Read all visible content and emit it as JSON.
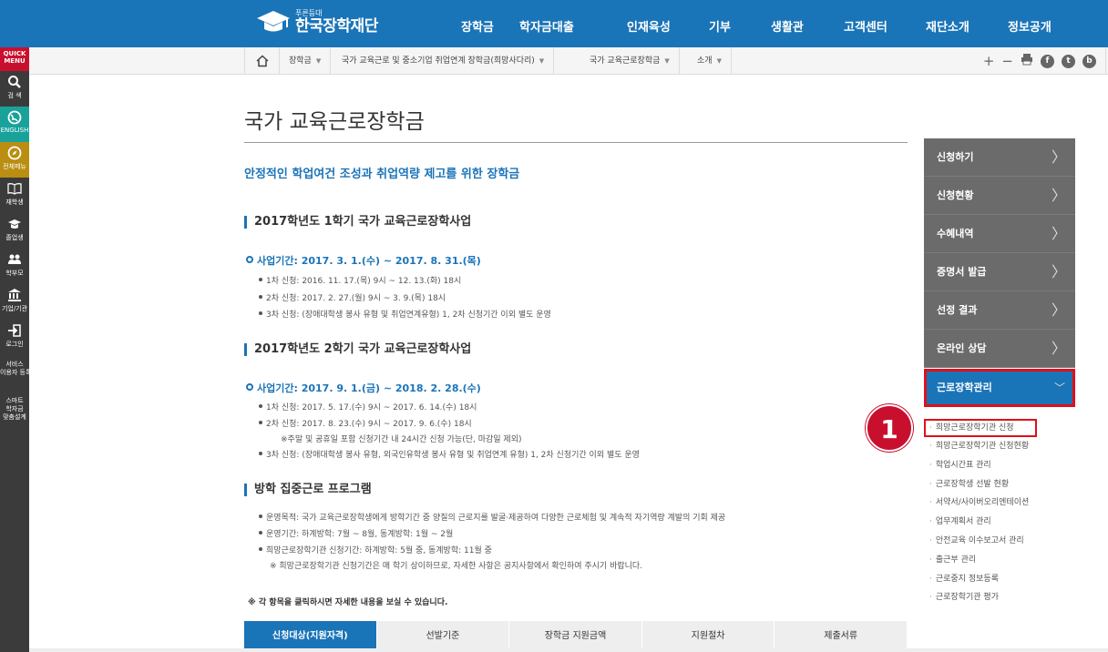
{
  "header": {
    "logo_small": "푸른등대",
    "logo_big": "한국장학재단",
    "nav": [
      "장학금",
      "학자금대출",
      "인재육성",
      "기부",
      "생활관",
      "고객센터",
      "재단소개",
      "정보공개"
    ]
  },
  "quick_menu": {
    "title_line1": "QUICK",
    "title_line2": "MENU",
    "items": [
      {
        "label": "검 색",
        "icon": "search-icon"
      },
      {
        "label": "ENGLISH",
        "icon": "globe-icon"
      },
      {
        "label": "전체메뉴",
        "icon": "compass-icon"
      },
      {
        "label": "재학생",
        "icon": "book-icon"
      },
      {
        "label": "졸업생",
        "icon": "graduation-cap-icon"
      },
      {
        "label": "학부모",
        "icon": "parents-icon"
      },
      {
        "label": "기업/기관",
        "icon": "institution-icon"
      },
      {
        "label": "로그인",
        "icon": "login-icon"
      },
      {
        "label_line1": "서비스",
        "label_line2": "이용자 등록"
      },
      {
        "label_line1": "스마트",
        "label_line2": "학자금",
        "label_line3": "맞춤설계"
      }
    ]
  },
  "breadcrumb": {
    "home_icon": "home-icon",
    "items": [
      "장학금",
      "국가 교육근로 및 중소기업 취업연계 장학금(희망사다리)",
      "국가 교육근로장학금",
      "소개"
    ]
  },
  "tools": {
    "zoom_in": "+",
    "zoom_out": "−",
    "print": "print-icon",
    "facebook": "f",
    "twitter": "t",
    "blog": "b"
  },
  "main": {
    "title": "국가 교육근로장학금",
    "subtitle": "안정적인 학업여건 조성과 취업역량 제고를 위한 장학금",
    "section1": {
      "heading": "2017학년도 1학기 국가 교육근로장학사업",
      "period": "사업기간: 2017. 3. 1.(수) ~ 2017. 8. 31.(목)",
      "bullets": [
        "1차 신청: 2016. 11. 17.(목) 9시 ~ 12. 13.(화) 18시",
        "2차 신청: 2017. 2. 27.(월) 9시 ~ 3. 9.(목) 18시",
        "3차 신청: (장애대학생 봉사 유형 및 취업연계유형) 1, 2차 신청기간 이외 별도 운영"
      ]
    },
    "section2": {
      "heading": "2017학년도 2학기 국가 교육근로장학사업",
      "period": "사업기간: 2017. 9. 1.(금) ~ 2018. 2. 28.(수)",
      "bullets": [
        "1차 신청: 2017. 5. 17.(수) 9시 ~ 2017. 6. 14.(수) 18시",
        "2차 신청: 2017. 8. 23.(수) 9시 ~ 2017. 9. 6.(수) 18시",
        "※주말 및 공휴일 포함 신청기간 내 24시간 신청 가능(단, 마감일 제외)",
        "3차 신청: (장애대학생 봉사 유형, 외국인유학생 봉사 유형 및 취업연계 유형) 1, 2차 신청기간 이외 별도 운영"
      ]
    },
    "section3": {
      "heading": "방학 집중근로 프로그램",
      "bullets": [
        "운영목적: 국가 교육근로장학생에게 방학기간 중 양질의 근로지를 발굴·제공하여 다양한 근로체험 및 계속적 자기역량 계발의 기회 제공",
        "운영기간: 하계방학: 7월 ~ 8월, 동계방학: 1월 ~ 2월",
        "희망근로장학기관 신청기간: 하계방학: 5월 중, 동계방학: 11월 중",
        "※ 희망근로장학기관 신청기간은 매 학기 상이하므로, 자세한 사항은 공지사항에서 확인하여 주시기 바랍니다."
      ]
    },
    "footnote": "※ 각 항목을 클릭하시면 자세한 내용을 보실 수 있습니다.",
    "tabs": [
      "신청대상(지원자격)",
      "선발기준",
      "장학금 지원금액",
      "지원절차",
      "제출서류"
    ]
  },
  "right_menu": {
    "items": [
      "신청하기",
      "신청현황",
      "수혜내역",
      "증명서 발급",
      "선정 결과",
      "온라인 상담"
    ],
    "active": "근로장학관리",
    "sub_items": [
      "희망근로장학기관 신청",
      "희망근로장학기관 신청현황",
      "학업시간표 관리",
      "근로장학생 선발 현황",
      "서약서/사이버오리엔테이션",
      "업무계획서 관리",
      "안전교육 이수보고서 관리",
      "출근부 관리",
      "근로중지 정보등록",
      "근로장학기관 평가"
    ]
  },
  "annotation_badge": "1",
  "colors": {
    "brand_blue": "#1a74b8",
    "highlight_red": "#e0101a",
    "menu_gray": "#6b6b6b"
  }
}
